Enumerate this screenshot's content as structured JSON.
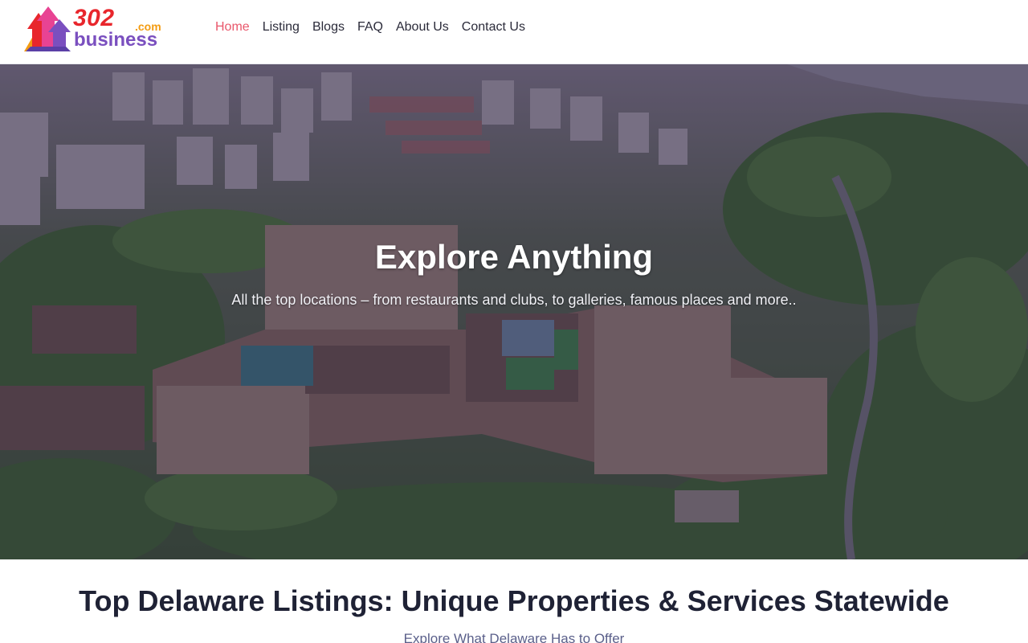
{
  "brand": {
    "number": "302",
    "tld": ".com",
    "word": "business"
  },
  "nav": {
    "items": [
      {
        "label": "Home",
        "active": true
      },
      {
        "label": "Listing",
        "active": false
      },
      {
        "label": "Blogs",
        "active": false
      },
      {
        "label": "FAQ",
        "active": false
      },
      {
        "label": "About Us",
        "active": false
      },
      {
        "label": "Contact Us",
        "active": false
      }
    ]
  },
  "hero": {
    "title": "Explore Anything",
    "subtitle": "All the top locations – from restaurants and clubs, to galleries, famous places and more.."
  },
  "listings": {
    "title": "Top Delaware Listings: Unique Properties & Services Statewide",
    "subtitle": "Explore What Delaware Has to Offer"
  },
  "colors": {
    "nav_active": "#e9576b",
    "logo_red": "#e8262c",
    "logo_orange": "#f39c12",
    "logo_purple": "#7a4fbf",
    "hero_overlay": "#2a2246"
  }
}
